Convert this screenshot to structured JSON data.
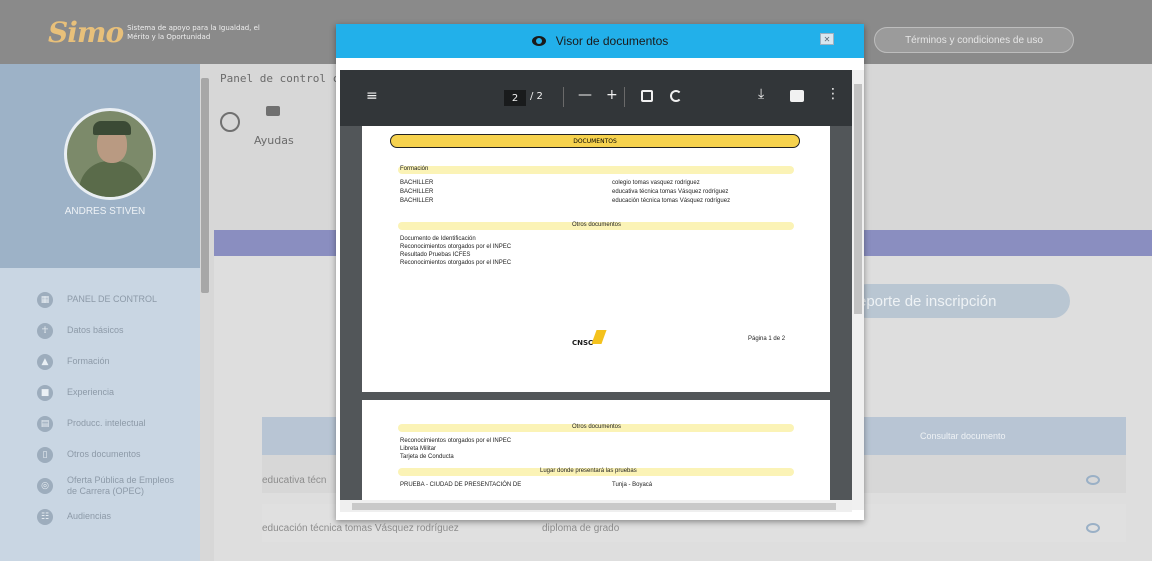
{
  "header": {
    "logo_mark": "Simo",
    "logo_sub": "Sistema de apoyo para la Igualdad, el Mérito y la Oportunidad",
    "terms_button": "Términos y condiciones de uso"
  },
  "sidebar": {
    "username": "ANDRES STIVEN",
    "items": [
      {
        "label": "PANEL DE CONTROL",
        "icon": "dashboard-icon"
      },
      {
        "label": "Datos básicos",
        "icon": "people-icon"
      },
      {
        "label": "Formación",
        "icon": "graduation-icon"
      },
      {
        "label": "Experiencia",
        "icon": "briefcase-icon"
      },
      {
        "label": "Producc. intelectual",
        "icon": "book-icon"
      },
      {
        "label": "Otros documentos",
        "icon": "document-icon"
      },
      {
        "label": "Oferta Pública de Empleos de Carrera (OPEC)",
        "icon": "compass-icon"
      },
      {
        "label": "Audiencias",
        "icon": "audience-icon"
      }
    ]
  },
  "main": {
    "breadcrumb": "Panel de control ciud",
    "ayudas_label": "Ayudas",
    "reporte_button": "eporte de inscripción",
    "table_header_consultar": "Consultar documento",
    "rows": [
      {
        "col1": "educativa técn",
        "col2": ""
      },
      {
        "col1": "educación técnica tomas Vásquez rodríguez",
        "col2": "diploma de grado"
      }
    ]
  },
  "viewer": {
    "title": "Visor de documentos",
    "close": "✕",
    "toolbar": {
      "menu": "≡",
      "page_current": "2",
      "page_total": "/ 2",
      "zoom_out": "—",
      "zoom_in": "+",
      "download": "⤓",
      "more": "⋮"
    },
    "page1": {
      "section_title": "DOCUMENTOS",
      "formacion_label": "Formación",
      "formacion_rows": [
        {
          "title": "BACHILLER",
          "institution": "colegio tomas vasquez rodriguez"
        },
        {
          "title": "BACHILLER",
          "institution": "educativa técnica tomas Vásquez rodríguez"
        },
        {
          "title": "BACHILLER",
          "institution": "educación técnica tomas Vásquez rodríguez"
        }
      ],
      "otros_label": "Otros documentos",
      "otros_items": [
        "Documento de Identificación",
        "Reconocimientos otorgados por el INPEC",
        "Resultado Pruebas ICFES",
        "Reconocimientos otorgados por el INPEC"
      ],
      "footer_logo": "CNSC",
      "page_number": "Página 1 de 2"
    },
    "page2": {
      "otros_label": "Otros documentos",
      "otros_items": [
        "Reconocimientos otorgados por el INPEC",
        "Libreta Militar",
        "Tarjeta de Conducta"
      ],
      "lugar_label": "Lugar donde presentará las pruebas",
      "prueba_label": "PRUEBA - CIUDAD DE PRESENTACIÓN DE",
      "prueba_city": "Tunja - Boyacá"
    }
  }
}
